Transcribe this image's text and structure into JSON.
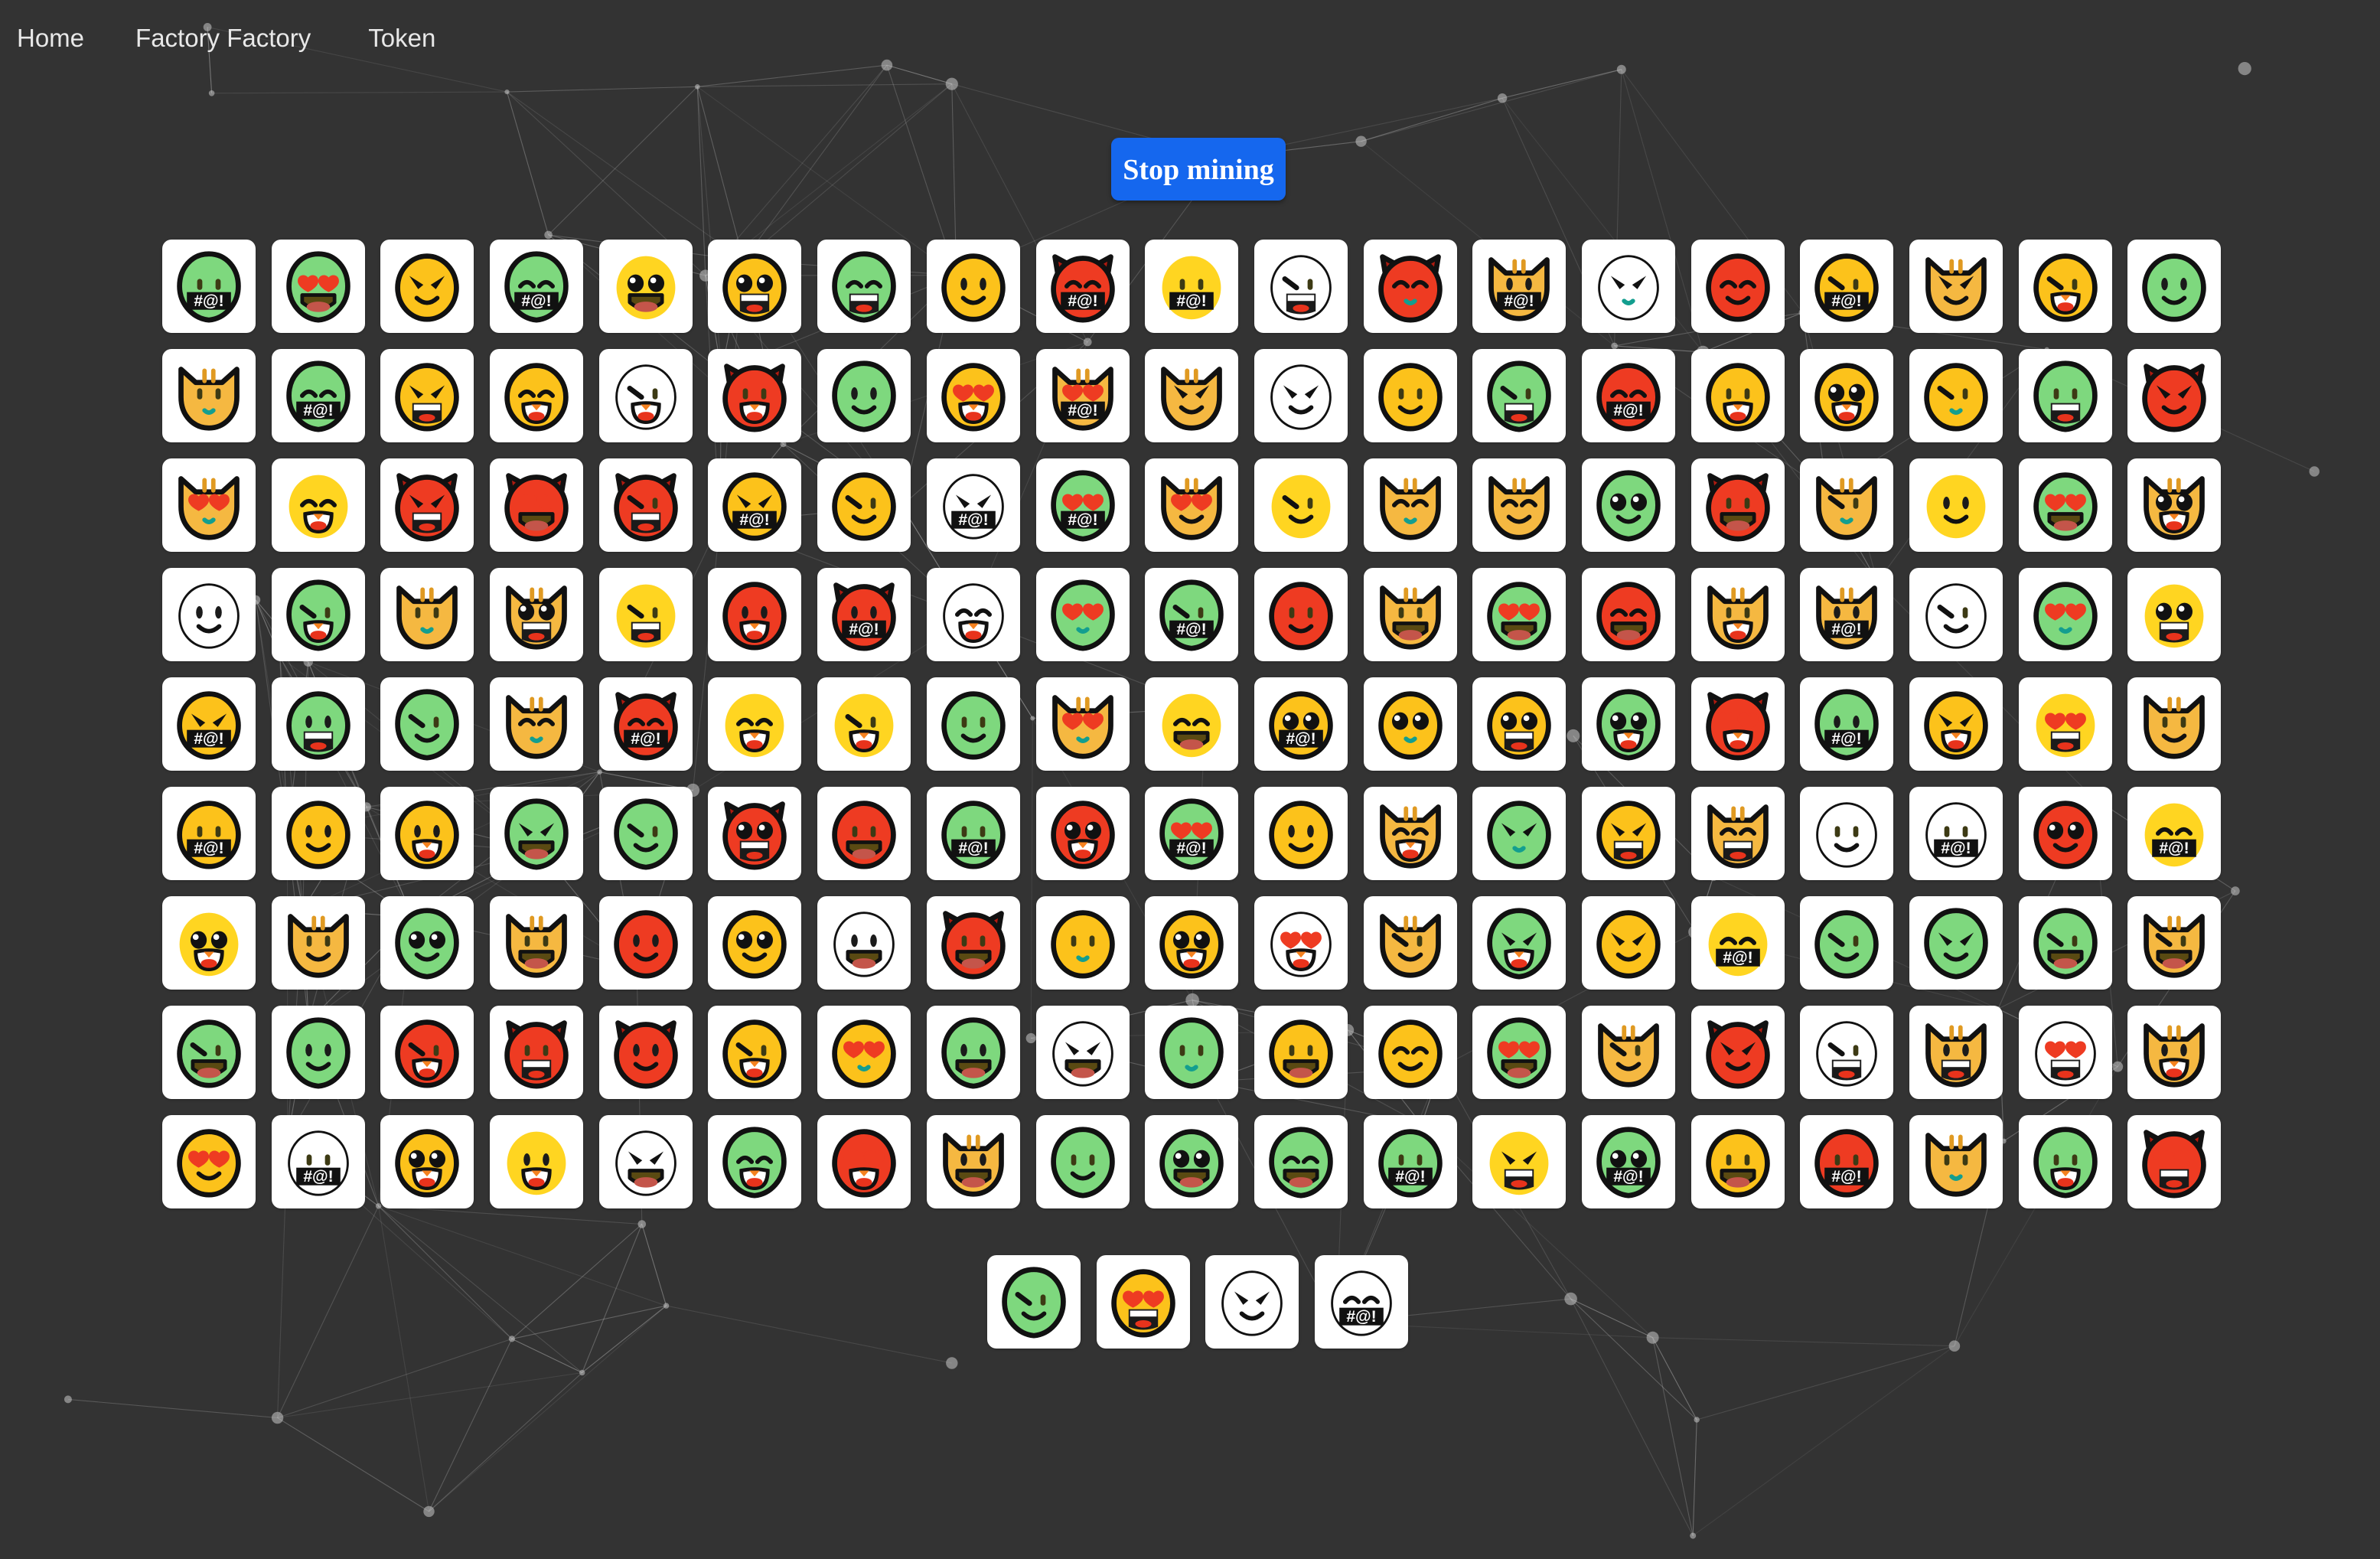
{
  "page": {
    "background_color": "#333333",
    "tile_color": "#ffffff"
  },
  "navbar": {
    "items": [
      {
        "label": "Home",
        "name": "nav-link-home"
      },
      {
        "label": "Factory Factory",
        "name": "nav-link-factory-factory"
      },
      {
        "label": "Token",
        "name": "nav-link-token"
      }
    ]
  },
  "controls": {
    "mining_button_label": "Stop mining",
    "mining_button_color": "#1567ee",
    "mining_button_text_color": "#ffffff"
  },
  "grid": {
    "columns": 19,
    "full_rows": 9,
    "tail_count": 4,
    "total_tiles": 175,
    "tile_size_px": 122,
    "tile_radius_px": 12,
    "censor_text": "#@!",
    "palette": {
      "yellow": "#fcc21b",
      "yellow_bright": "#ffd521",
      "green": "#7ed87e",
      "red": "#ee3b22",
      "cat_orange": "#f5b841",
      "white": "#ffffff",
      "outline": "#111111",
      "mouth_red": "#e8331c",
      "teal": "#139e8f",
      "heart": "#ee3b22"
    },
    "shapes": [
      "round",
      "devil",
      "cat",
      "alien"
    ],
    "eyes": [
      "dot",
      "oval",
      "happy",
      "angry",
      "heart",
      "wink",
      "big"
    ],
    "mouths": [
      "smile",
      "open",
      "grin",
      "teeth",
      "small",
      "none"
    ],
    "faces": [
      [
        "devil-red-open",
        "devil-red-plain",
        "alien-green-teeth",
        "alien-green-grin",
        "devil-red-censor",
        "cat-yellow-grin",
        "round-yellow-happy",
        "round-white-grin",
        "cat-yellow-censor",
        "round-white-grin2",
        "cat-yellow-grin3",
        "round-yellow-happy2",
        "cat-yellow-wink",
        "devil-red-happy",
        "cat-yellow-heartcensor",
        "cat-yellow-heart",
        "devil-red-angry",
        "alien-green-censor",
        "devil-red-plain2"
      ],
      [
        "alien-green-open",
        "round-yellow-happy3",
        "cat-yellow-grin4",
        "devil-red-censor2",
        "round-yellow-heartcensor",
        "cat-yellow-grin5",
        "round-yellow-heartcensor2",
        "round-yellow-angry",
        "alien-green-wink",
        "cat-yellow-grin6",
        "round-yellow-big",
        "cat-yellow-grin7",
        "round-white-happy",
        "alien-green-plain",
        "alien-green-censor2",
        "round-yellow-angry2",
        "round-red-teeth",
        "alien-green-open2",
        "round-white-heart"
      ],
      [
        "round-yellow-censor",
        "round-red-plain",
        "round-red-teeth2",
        "round-red-censor",
        "round-yellow-big2",
        "round-yellow-grin",
        "round-yellow-grin2",
        "round-yellow-censor2",
        "devil-red-open2",
        "round-yellow-censor3",
        "round-white-angry",
        "round-yellow-heart",
        "round-red-happy",
        "round-yellow-teeth",
        "round-yellow-heartcensor3",
        "devil-red-heart",
        "devil-red-plain3",
        "round-yellow-grin3",
        "round-yellow-angry3"
      ],
      [
        "round-yellow-big3",
        "devil-red-angry2",
        "cat-yellow-grin8",
        "round-white-open",
        "devil-red-plain4",
        "round-red-teeth3",
        "cat-yellow-plain",
        "alien-green-open3",
        "round-white-open2",
        "devil-red-censor3",
        "round-red-open",
        "round-white-open3",
        "cat-yellow-heart2",
        "round-white-open4",
        "round-white-grin4",
        "round-yellow-open",
        "round-white-censor",
        "alien-green-wink2",
        "round-red-open2"
      ],
      [
        "alien-green-big",
        "round-yellow-angry4",
        "alien-green-angry",
        "cat-yellow-grin9",
        "round-red-big",
        "round-yellow-censor4",
        "round-yellow-heart2",
        "devil-red-open3",
        "round-yellow-big4",
        "alien-green-open4",
        "round-red-heart",
        "alien-green-plain2",
        "round-yellow-plain",
        "devil-red-plain5",
        "devil-red-heart2",
        "round-yellow-angry5",
        "devil-red-plain6",
        "devil-red-censor4",
        "round-yellow-angry6"
      ],
      [
        "round-yellow-plain2",
        "round-yellow-plain3",
        "cat-yellow-big",
        "devil-red-angry3",
        "devil-red-angry4",
        "devil-red-big",
        "cat-yellow-censor5",
        "alien-green-plain3",
        "cat-yellow-plain2",
        "round-yellow-plain4",
        "devil-red-open4",
        "cat-yellow-plain3",
        "round-white-heartcensor",
        "alien-green-grin2",
        "round-red-open3",
        "cat-yellow-big2",
        "round-red-grin",
        "round-yellow-angry7",
        "devil-red-open5"
      ],
      [
        "devil-red-plain7",
        "devil-red-plain8",
        "round-yellow-censor5",
        "alien-green-big2",
        "round-yellow-open2",
        "alien-green-censor3",
        "round-green-grin",
        "round-white-big",
        "alien-green-open5",
        "devil-red-plain9",
        "devil-red-open6",
        "round-yellow-censor6",
        "round-yellow-open3",
        "round-red-teeth4",
        "round-red-open4",
        "round-red-open5",
        "round-red-heart3",
        "round-yellow-angry8",
        "round-white-plain"
      ],
      [
        "round-yellow-open4",
        "devil-red-grin",
        "devil-red-plain10",
        "round-yellow-angry9",
        "alien-green-censor4",
        "round-red-plain2",
        "round-yellow-angry10",
        "round-white-censor2",
        "alien-green-plain4",
        "cat-yellow-plain4",
        "alien-green-plain5",
        "alien-green-plain6",
        "cat-yellow-censor7",
        "round-yellow-heart3",
        "devil-red-heart4",
        "round-yellow-plain5",
        "cat-yellow-grin10",
        "round-white-teeth"
      ],
      [
        "alien-green-open6",
        "cat-yellow-plain5",
        "alien-green-open7",
        "alien-green-censor5",
        "alien-green-censor6",
        "round-red-grin2",
        "cat-yellow-grin11",
        "alien-green-plain7",
        "round-yellow-heart4",
        "devil-red-plain11",
        "devil-red-open7",
        "round-white-teeth2",
        "round-red-censor2",
        "devil-red-teeth",
        "round-red-plain3",
        "devil-red-censor5",
        "cat-yellow-teeth",
        "alien-green-heart",
        "round-yellow-plain6"
      ]
    ],
    "tail_faces": [
      "cat-yellow-wink2",
      "devil-red-open8",
      "round-yellow-plain7",
      "round-yellow-wink"
    ]
  }
}
